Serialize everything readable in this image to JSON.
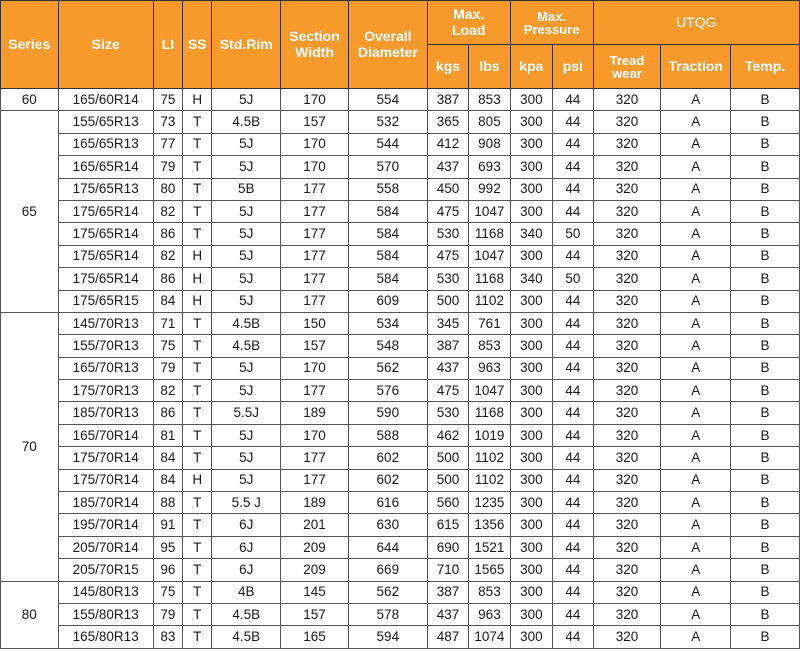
{
  "headers": {
    "series": "Series",
    "size": "Size",
    "li": "LI",
    "ss": "SS",
    "std_rim": "Std.Rim",
    "section_width": [
      "Section",
      "Width"
    ],
    "overall_diameter": [
      "Overall",
      "Diameter"
    ],
    "max_load": [
      "Max.",
      "Load"
    ],
    "max_pressure": [
      "Max.",
      "Pressure"
    ],
    "utqg": "UTQG",
    "kgs": "kgs",
    "lbs": "lbs",
    "kpa": "kpa",
    "psi": "psi",
    "treadwear": [
      "Tread",
      "wear"
    ],
    "traction": "Traction",
    "temp": "Temp."
  },
  "groups": [
    {
      "series": "60",
      "rows": [
        [
          "165/60R14",
          "75",
          "H",
          "5J",
          "170",
          "554",
          "387",
          "853",
          "300",
          "44",
          "320",
          "A",
          "B"
        ]
      ]
    },
    {
      "series": "65",
      "rows": [
        [
          "155/65R13",
          "73",
          "T",
          "4.5B",
          "157",
          "532",
          "365",
          "805",
          "300",
          "44",
          "320",
          "A",
          "B"
        ],
        [
          "165/65R13",
          "77",
          "T",
          "5J",
          "170",
          "544",
          "412",
          "908",
          "300",
          "44",
          "320",
          "A",
          "B"
        ],
        [
          "165/65R14",
          "79",
          "T",
          "5J",
          "170",
          "570",
          "437",
          "693",
          "300",
          "44",
          "320",
          "A",
          "B"
        ],
        [
          "175/65R13",
          "80",
          "T",
          "5B",
          "177",
          "558",
          "450",
          "992",
          "300",
          "44",
          "320",
          "A",
          "B"
        ],
        [
          "175/65R14",
          "82",
          "T",
          "5J",
          "177",
          "584",
          "475",
          "1047",
          "300",
          "44",
          "320",
          "A",
          "B"
        ],
        [
          "175/65R14",
          "86",
          "T",
          "5J",
          "177",
          "584",
          "530",
          "1168",
          "340",
          "50",
          "320",
          "A",
          "B"
        ],
        [
          "175/65R14",
          "82",
          "H",
          "5J",
          "177",
          "584",
          "475",
          "1047",
          "300",
          "44",
          "320",
          "A",
          "B"
        ],
        [
          "175/65R14",
          "86",
          "H",
          "5J",
          "177",
          "584",
          "530",
          "1168",
          "340",
          "50",
          "320",
          "A",
          "B"
        ],
        [
          "175/65R15",
          "84",
          "H",
          "5J",
          "177",
          "609",
          "500",
          "1102",
          "300",
          "44",
          "320",
          "A",
          "B"
        ]
      ]
    },
    {
      "series": "70",
      "rows": [
        [
          "145/70R13",
          "71",
          "T",
          "4.5B",
          "150",
          "534",
          "345",
          "761",
          "300",
          "44",
          "320",
          "A",
          "B"
        ],
        [
          "155/70R13",
          "75",
          "T",
          "4.5B",
          "157",
          "548",
          "387",
          "853",
          "300",
          "44",
          "320",
          "A",
          "B"
        ],
        [
          "165/70R13",
          "79",
          "T",
          "5J",
          "170",
          "562",
          "437",
          "963",
          "300",
          "44",
          "320",
          "A",
          "B"
        ],
        [
          "175/70R13",
          "82",
          "T",
          "5J",
          "177",
          "576",
          "475",
          "1047",
          "300",
          "44",
          "320",
          "A",
          "B"
        ],
        [
          "185/70R13",
          "86",
          "T",
          "5.5J",
          "189",
          "590",
          "530",
          "1168",
          "300",
          "44",
          "320",
          "A",
          "B"
        ],
        [
          "165/70R14",
          "81",
          "T",
          "5J",
          "170",
          "588",
          "462",
          "1019",
          "300",
          "44",
          "320",
          "A",
          "B"
        ],
        [
          "175/70R14",
          "84",
          "T",
          "5J",
          "177",
          "602",
          "500",
          "1102",
          "300",
          "44",
          "320",
          "A",
          "B"
        ],
        [
          "175/70R14",
          "84",
          "H",
          "5J",
          "177",
          "602",
          "500",
          "1102",
          "300",
          "44",
          "320",
          "A",
          "B"
        ],
        [
          "185/70R14",
          "88",
          "T",
          "5.5 J",
          "189",
          "616",
          "560",
          "1235",
          "300",
          "44",
          "320",
          "A",
          "B"
        ],
        [
          "195/70R14",
          "91",
          "T",
          "6J",
          "201",
          "630",
          "615",
          "1356",
          "300",
          "44",
          "320",
          "A",
          "B"
        ],
        [
          "205/70R14",
          "95",
          "T",
          "6J",
          "209",
          "644",
          "690",
          "1521",
          "300",
          "44",
          "320",
          "A",
          "B"
        ],
        [
          "205/70R15",
          "96",
          "T",
          "6J",
          "209",
          "669",
          "710",
          "1565",
          "300",
          "44",
          "320",
          "A",
          "B"
        ]
      ]
    },
    {
      "series": "80",
      "rows": [
        [
          "145/80R13",
          "75",
          "T",
          "4B",
          "145",
          "562",
          "387",
          "853",
          "300",
          "44",
          "320",
          "A",
          "B"
        ],
        [
          "155/80R13",
          "79",
          "T",
          "4.5B",
          "157",
          "578",
          "437",
          "963",
          "300",
          "44",
          "320",
          "A",
          "B"
        ],
        [
          "165/80R13",
          "83",
          "T",
          "4.5B",
          "165",
          "594",
          "487",
          "1074",
          "300",
          "44",
          "320",
          "A",
          "B"
        ]
      ]
    }
  ]
}
